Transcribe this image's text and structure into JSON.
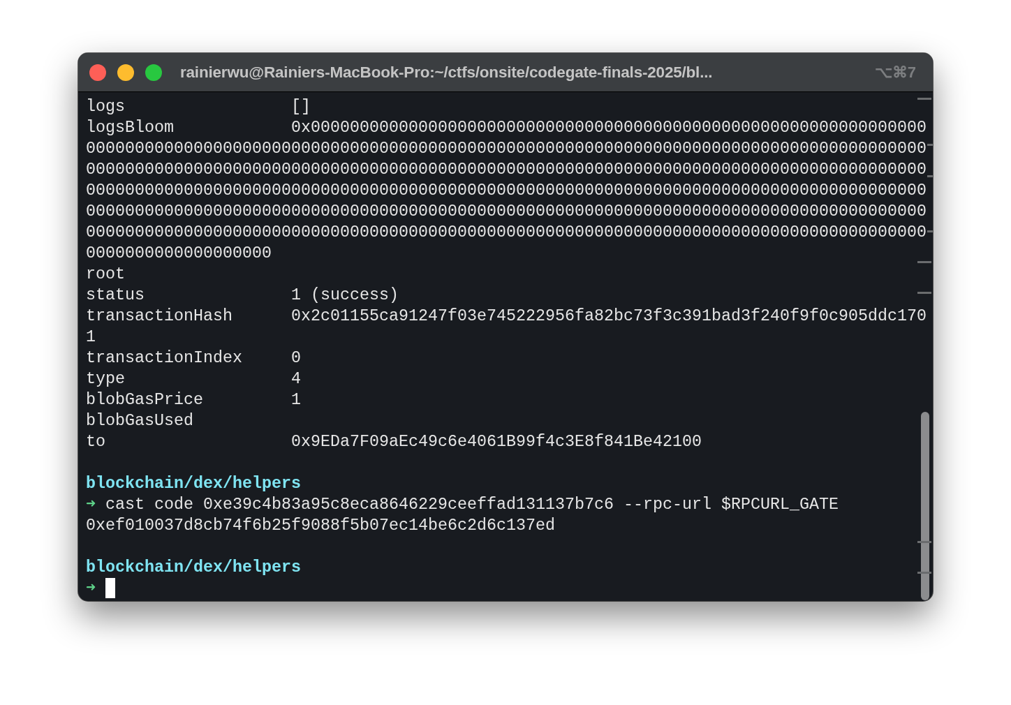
{
  "window": {
    "title": "rainierwu@Rainiers-MacBook-Pro:~/ctfs/onsite/codegate-finals-2025/bl...",
    "shortcut": "⌥⌘7"
  },
  "terminal": {
    "lines": [
      {
        "kind": "field",
        "key": "logs",
        "value": "[]"
      },
      {
        "kind": "field",
        "key": "logsBloom",
        "value": "0x000000000000000000000000000000000000000000000000000000000000000"
      },
      {
        "kind": "output",
        "text": "00000000000000000000000000000000000000000000000000000000000000000000000000000000000000"
      },
      {
        "kind": "output",
        "text": "00000000000000000000000000000000000000000000000000000000000000000000000000000000000000"
      },
      {
        "kind": "output",
        "text": "00000000000000000000000000000000000000000000000000000000000000000000000000000000000000"
      },
      {
        "kind": "output",
        "text": "00000000000000000000000000000000000000000000000000000000000000000000000000000000000000"
      },
      {
        "kind": "output",
        "text": "00000000000000000000000000000000000000000000000000000000000000000000000000000000000000"
      },
      {
        "kind": "output",
        "text": "0000000000000000000"
      },
      {
        "kind": "field",
        "key": "root"
      },
      {
        "kind": "field",
        "key": "status",
        "value": "1 (success)"
      },
      {
        "kind": "field",
        "key": "transactionHash",
        "value": "0x2c01155ca91247f03e745222956fa82bc73f3c391bad3f240f9f0c905ddc170"
      },
      {
        "kind": "output",
        "text": "1"
      },
      {
        "kind": "field",
        "key": "transactionIndex",
        "value": "0"
      },
      {
        "kind": "field",
        "key": "type",
        "value": "4"
      },
      {
        "kind": "field",
        "key": "blobGasPrice",
        "value": "1"
      },
      {
        "kind": "field",
        "key": "blobGasUsed"
      },
      {
        "kind": "field",
        "key": "to",
        "value": "0x9EDa7F09aEc49c6e4061B99f4c3E8f841Be42100"
      },
      {
        "kind": "blank"
      },
      {
        "kind": "cwd",
        "text": "blockchain/dex/helpers"
      },
      {
        "kind": "command",
        "arrow": "➜",
        "text": "cast code 0xe39c4b83a95c8eca8646229ceeffad131137b7c6 --rpc-url $RPCURL_GATE"
      },
      {
        "kind": "output",
        "text": "0xef010037d8cb74f6b25f9088f5b07ec14be6c2d6c137ed"
      },
      {
        "kind": "blank"
      },
      {
        "kind": "cwd",
        "text": "blockchain/dex/helpers"
      },
      {
        "kind": "prompt",
        "arrow": "➜"
      }
    ]
  }
}
